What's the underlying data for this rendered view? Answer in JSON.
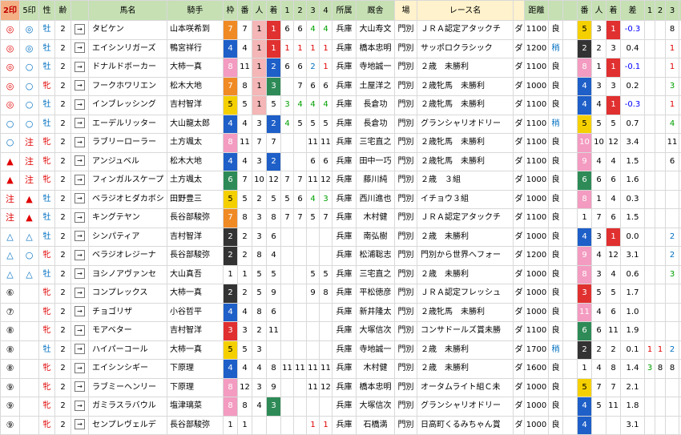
{
  "headers": [
    "2印",
    "5印",
    "性",
    "齢",
    "",
    "馬名",
    "騎手",
    "枠",
    "番",
    "人",
    "着",
    "1",
    "2",
    "3",
    "4",
    "所属",
    "厩舎",
    "場",
    "レース名",
    "",
    "距離",
    "",
    "",
    "番",
    "人",
    "着",
    "差",
    "1",
    "2",
    "3",
    "4"
  ],
  "rows": [
    {
      "m2": "◎",
      "m5": "◎",
      "sex": "牡",
      "age": "2",
      "name": "タビケン",
      "jockey": "山本咲希到",
      "waku": "7",
      "ban": "7",
      "pop": "1",
      "fin": "1",
      "c1": "6",
      "c2": "6",
      "c3": "4",
      "c4": "4",
      "loc": "兵庫",
      "trainer": "大山寿文",
      "track": "門別",
      "race": "ＪＲＡ認定アタックチ",
      "surf": "ダ",
      "dist": "1100",
      "cond": "良",
      "pban": "5",
      "ppop": "3",
      "pfin": "1",
      "diff": "-0.3",
      "p1": "",
      "p2": "",
      "p3": "8",
      "p4": "7"
    },
    {
      "m2": "◎",
      "m5": "◎",
      "sex": "牡",
      "age": "2",
      "name": "エイシンリガーズ",
      "jockey": "鴨宮祥行",
      "waku": "4",
      "ban": "4",
      "pop": "1",
      "fin": "1",
      "c1": "1",
      "c2": "1",
      "c3": "1",
      "c4": "1",
      "loc": "兵庫",
      "trainer": "橋本忠明",
      "track": "門別",
      "race": "サッポロクラシック",
      "surf": "ダ",
      "dist": "1200",
      "cond": "稍",
      "pban": "2",
      "ppop": "2",
      "pfin": "3",
      "diff": "0.4",
      "p1": "",
      "p2": "",
      "p3": "1",
      "p4": "1"
    },
    {
      "m2": "◎",
      "m5": "○",
      "sex": "牡",
      "age": "2",
      "name": "ドナルドボーカー",
      "jockey": "大柿一真",
      "waku": "8",
      "ban": "11",
      "pop": "1",
      "fin": "2",
      "c1": "6",
      "c2": "6",
      "c3": "2",
      "c4": "1",
      "loc": "兵庫",
      "trainer": "寺地誠一",
      "track": "門別",
      "race": "２歳　未勝利",
      "surf": "ダ",
      "dist": "1100",
      "cond": "良",
      "pban": "8",
      "ppop": "1",
      "pfin": "1",
      "diff": "-0.1",
      "p1": "",
      "p2": "",
      "p3": "1",
      "p4": "1"
    },
    {
      "m2": "◎",
      "m5": "○",
      "sex": "牝",
      "age": "2",
      "name": "フークホワリエン",
      "jockey": "松木大地",
      "waku": "7",
      "ban": "8",
      "pop": "1",
      "fin": "3",
      "c1": "",
      "c2": "7",
      "c3": "6",
      "c4": "6",
      "loc": "兵庫",
      "trainer": "土屋洋之",
      "track": "門別",
      "race": "２歳牝馬　未勝利",
      "surf": "ダ",
      "dist": "1000",
      "cond": "良",
      "pban": "4",
      "ppop": "3",
      "pfin": "3",
      "diff": "0.2",
      "p1": "",
      "p2": "",
      "p3": "3",
      "p4": "3"
    },
    {
      "m2": "◎",
      "m5": "○",
      "sex": "牡",
      "age": "2",
      "name": "インブレッシング",
      "jockey": "吉村智洋",
      "waku": "5",
      "ban": "5",
      "pop": "1",
      "fin": "5",
      "c1": "3",
      "c2": "4",
      "c3": "4",
      "c4": "4",
      "loc": "兵庫",
      "trainer": "長倉功",
      "track": "門別",
      "race": "２歳牝馬　未勝利",
      "surf": "ダ",
      "dist": "1100",
      "cond": "良",
      "pban": "4",
      "ppop": "4",
      "pfin": "1",
      "diff": "-0.3",
      "p1": "",
      "p2": "",
      "p3": "1",
      "p4": "1"
    },
    {
      "m2": "○",
      "m5": "○",
      "sex": "牡",
      "age": "2",
      "name": "エーデルリッター",
      "jockey": "大山龍太郎",
      "waku": "4",
      "ban": "4",
      "pop": "3",
      "fin": "2",
      "c1": "4",
      "c2": "5",
      "c3": "5",
      "c4": "5",
      "loc": "兵庫",
      "trainer": "長倉功",
      "track": "門別",
      "race": "グランシャリオドリー",
      "surf": "ダ",
      "dist": "1100",
      "cond": "稍",
      "pban": "5",
      "ppop": "5",
      "pfin": "5",
      "diff": "0.7",
      "p1": "",
      "p2": "",
      "p3": "4",
      "p4": "4"
    },
    {
      "m2": "○",
      "m5": "注",
      "sex": "牝",
      "age": "2",
      "name": "ラブリーローラー",
      "jockey": "土方颯太",
      "waku": "8",
      "ban": "11",
      "pop": "7",
      "fin": "7",
      "c1": "",
      "c2": "",
      "c3": "11",
      "c4": "11",
      "loc": "兵庫",
      "trainer": "三宅直之",
      "track": "門別",
      "race": "２歳牝馬　未勝利",
      "surf": "ダ",
      "dist": "1100",
      "cond": "良",
      "pban": "10",
      "ppop": "10",
      "pfin": "12",
      "diff": "3.4",
      "p1": "",
      "p2": "",
      "p3": "11",
      "p4": "10"
    },
    {
      "m2": "▲",
      "m5": "注",
      "sex": "牝",
      "age": "2",
      "name": "アンジュベル",
      "jockey": "松木大地",
      "waku": "4",
      "ban": "4",
      "pop": "3",
      "fin": "2",
      "c1": "",
      "c2": "",
      "c3": "6",
      "c4": "6",
      "loc": "兵庫",
      "trainer": "田中一巧",
      "track": "門別",
      "race": "２歳牝馬　未勝利",
      "surf": "ダ",
      "dist": "1100",
      "cond": "良",
      "pban": "9",
      "ppop": "4",
      "pfin": "4",
      "diff": "1.5",
      "p1": "",
      "p2": "",
      "p3": "6",
      "p4": "4"
    },
    {
      "m2": "▲",
      "m5": "注",
      "sex": "牝",
      "age": "2",
      "name": "フィンガルスケープ",
      "jockey": "土方颯太",
      "waku": "6",
      "ban": "7",
      "pop": "10",
      "fin": "12",
      "c1": "7",
      "c2": "7",
      "c3": "11",
      "c4": "12",
      "loc": "兵庫",
      "trainer": "藤川純",
      "track": "門別",
      "race": "２歳　３組",
      "surf": "ダ",
      "dist": "1000",
      "cond": "良",
      "pban": "6",
      "ppop": "6",
      "pfin": "6",
      "diff": "1.6",
      "p1": "",
      "p2": "",
      "p3": "",
      "p4": "7"
    },
    {
      "m2": "注",
      "m5": "▲",
      "sex": "牡",
      "age": "2",
      "name": "ベラジオヒダカボシ",
      "jockey": "田野豊三",
      "waku": "5",
      "ban": "5",
      "pop": "2",
      "fin": "5",
      "c1": "5",
      "c2": "6",
      "c3": "4",
      "c4": "3",
      "loc": "兵庫",
      "trainer": "西川進也",
      "track": "門別",
      "race": "イチョウ３組",
      "surf": "ダ",
      "dist": "1000",
      "cond": "良",
      "pban": "8",
      "ppop": "1",
      "pfin": "4",
      "diff": "0.3",
      "p1": "",
      "p2": "",
      "p3": "",
      "p4": "3"
    },
    {
      "m2": "注",
      "m5": "▲",
      "sex": "牡",
      "age": "2",
      "name": "キングテヤン",
      "jockey": "長谷部駿弥",
      "waku": "7",
      "ban": "8",
      "pop": "3",
      "fin": "8",
      "c1": "7",
      "c2": "7",
      "c3": "5",
      "c4": "7",
      "loc": "兵庫",
      "trainer": "木村健",
      "track": "門別",
      "race": "ＪＲＡ認定アタックチ",
      "surf": "ダ",
      "dist": "1100",
      "cond": "良",
      "pban": "1",
      "ppop": "7",
      "pfin": "6",
      "diff": "1.5",
      "p1": "",
      "p2": "",
      "p3": "",
      "p4": "5"
    },
    {
      "m2": "△",
      "m5": "△",
      "sex": "牡",
      "age": "2",
      "name": "シンパティア",
      "jockey": "吉村智洋",
      "waku": "2",
      "ban": "2",
      "pop": "3",
      "fin": "6",
      "c1": "",
      "c2": "",
      "c3": "",
      "c4": "",
      "loc": "兵庫",
      "trainer": "南弘樹",
      "track": "門別",
      "race": "２歳　未勝利",
      "surf": "ダ",
      "dist": "1000",
      "cond": "良",
      "pban": "4",
      "ppop": "3",
      "pfin": "1",
      "diff": "0.0",
      "p1": "",
      "p2": "",
      "p3": "2",
      "p4": "2"
    },
    {
      "m2": "△",
      "m5": "○",
      "sex": "牝",
      "age": "2",
      "name": "ベラジオレジーナ",
      "jockey": "長谷部駿弥",
      "waku": "2",
      "ban": "2",
      "pop": "8",
      "fin": "4",
      "c1": "",
      "c2": "",
      "c3": "",
      "c4": "",
      "loc": "兵庫",
      "trainer": "松浦聡志",
      "track": "門別",
      "race": "門別から世界へフォー",
      "surf": "ダ",
      "dist": "1200",
      "cond": "良",
      "pban": "9",
      "ppop": "4",
      "pfin": "12",
      "diff": "3.1",
      "p1": "",
      "p2": "",
      "p3": "2",
      "p4": "2"
    },
    {
      "m2": "△",
      "m5": "△",
      "sex": "牡",
      "age": "2",
      "name": "ヨシノアヴァンセ",
      "jockey": "大山真吾",
      "waku": "1",
      "ban": "1",
      "pop": "5",
      "fin": "5",
      "c1": "",
      "c2": "",
      "c3": "5",
      "c4": "5",
      "loc": "兵庫",
      "trainer": "三宅直之",
      "track": "門別",
      "race": "２歳　未勝利",
      "surf": "ダ",
      "dist": "1000",
      "cond": "良",
      "pban": "8",
      "ppop": "3",
      "pfin": "4",
      "diff": "0.6",
      "p1": "",
      "p2": "",
      "p3": "3",
      "p4": "3"
    },
    {
      "m2": "⑥",
      "m5": "",
      "sex": "牝",
      "age": "2",
      "name": "コンプレックス",
      "jockey": "大柿一真",
      "waku": "2",
      "ban": "2",
      "pop": "5",
      "fin": "9",
      "c1": "",
      "c2": "",
      "c3": "9",
      "c4": "8",
      "loc": "兵庫",
      "trainer": "平松徳彦",
      "track": "門別",
      "race": "ＪＲＡ認定フレッシュ",
      "surf": "ダ",
      "dist": "1000",
      "cond": "良",
      "pban": "3",
      "ppop": "5",
      "pfin": "5",
      "diff": "1.7",
      "p1": "",
      "p2": "",
      "p3": "",
      "p4": "6"
    },
    {
      "m2": "⑦",
      "m5": "",
      "sex": "牝",
      "age": "2",
      "name": "チョゴリザ",
      "jockey": "小谷哲平",
      "waku": "4",
      "ban": "4",
      "pop": "8",
      "fin": "6",
      "c1": "",
      "c2": "",
      "c3": "",
      "c4": "",
      "loc": "兵庫",
      "trainer": "新井隆太",
      "track": "門別",
      "race": "２歳牝馬　未勝利",
      "surf": "ダ",
      "dist": "1000",
      "cond": "良",
      "pban": "11",
      "ppop": "4",
      "pfin": "6",
      "diff": "1.0",
      "p1": "",
      "p2": "",
      "p3": "",
      "p4": "6"
    },
    {
      "m2": "⑧",
      "m5": "",
      "sex": "牝",
      "age": "2",
      "name": "モアベター",
      "jockey": "吉村智洋",
      "waku": "3",
      "ban": "3",
      "pop": "2",
      "fin": "11",
      "c1": "",
      "c2": "",
      "c3": "",
      "c4": "",
      "loc": "兵庫",
      "trainer": "大塚信次",
      "track": "門別",
      "race": "コンサドールズ賞未勝",
      "surf": "ダ",
      "dist": "1100",
      "cond": "良",
      "pban": "6",
      "ppop": "6",
      "pfin": "11",
      "diff": "1.9",
      "p1": "",
      "p2": "",
      "p3": "",
      "p4": "11"
    },
    {
      "m2": "⑧",
      "m5": "",
      "sex": "牡",
      "age": "2",
      "name": "ハイパーコール",
      "jockey": "大柿一真",
      "waku": "5",
      "ban": "5",
      "pop": "3",
      "fin": "",
      "c1": "",
      "c2": "",
      "c3": "",
      "c4": "",
      "loc": "兵庫",
      "trainer": "寺地誠一",
      "track": "門別",
      "race": "２歳　未勝利",
      "surf": "ダ",
      "dist": "1700",
      "cond": "稍",
      "pban": "2",
      "ppop": "2",
      "pfin": "2",
      "diff": "0.1",
      "p1": "1",
      "p2": "1",
      "p3": "2",
      "p4": "2"
    },
    {
      "m2": "⑧",
      "m5": "",
      "sex": "牝",
      "age": "2",
      "name": "エイシンシギー",
      "jockey": "下原理",
      "waku": "4",
      "ban": "4",
      "pop": "4",
      "fin": "8",
      "c1": "11",
      "c2": "11",
      "c3": "11",
      "c4": "11",
      "loc": "兵庫",
      "trainer": "木村健",
      "track": "門別",
      "race": "２歳　未勝利",
      "surf": "ダ",
      "dist": "1600",
      "cond": "良",
      "pban": "1",
      "ppop": "4",
      "pfin": "8",
      "diff": "1.4",
      "p1": "3",
      "p2": "8",
      "p3": "8",
      "p4": "8"
    },
    {
      "m2": "⑨",
      "m5": "",
      "sex": "牝",
      "age": "2",
      "name": "ラブミーヘンリー",
      "jockey": "下原理",
      "waku": "8",
      "ban": "12",
      "pop": "3",
      "fin": "9",
      "c1": "",
      "c2": "",
      "c3": "11",
      "c4": "12",
      "loc": "兵庫",
      "trainer": "橋本忠明",
      "track": "門別",
      "race": "オータムライト組Ｃ未",
      "surf": "ダ",
      "dist": "1000",
      "cond": "良",
      "pban": "5",
      "ppop": "7",
      "pfin": "7",
      "diff": "2.1",
      "p1": "",
      "p2": "",
      "p3": "",
      "p4": "7"
    },
    {
      "m2": "⑨",
      "m5": "",
      "sex": "牝",
      "age": "2",
      "name": "ガミラスラバウル",
      "jockey": "塩津璃菜",
      "waku": "8",
      "ban": "8",
      "pop": "4",
      "fin": "3",
      "c1": "",
      "c2": "",
      "c3": "",
      "c4": "",
      "loc": "兵庫",
      "trainer": "大塚信次",
      "track": "門別",
      "race": "グランシャリオドリー",
      "surf": "ダ",
      "dist": "1000",
      "cond": "良",
      "pban": "4",
      "ppop": "5",
      "pfin": "11",
      "diff": "1.8",
      "p1": "",
      "p2": "",
      "p3": "",
      "p4": "2"
    },
    {
      "m2": "⑨",
      "m5": "",
      "sex": "牝",
      "age": "2",
      "name": "センプレヴェルデ",
      "jockey": "長谷部駿弥",
      "waku": "1",
      "ban": "1",
      "pop": "",
      "fin": "",
      "c1": "",
      "c2": "",
      "c3": "1",
      "c4": "1",
      "loc": "兵庫",
      "trainer": "石橋満",
      "track": "門別",
      "race": "日高町くるみちゃん賞",
      "surf": "ダ",
      "dist": "1000",
      "cond": "良",
      "pban": "4",
      "ppop": "",
      "pfin": "",
      "diff": "3.1",
      "p1": "",
      "p2": "",
      "p3": "",
      "p4": "3"
    }
  ]
}
